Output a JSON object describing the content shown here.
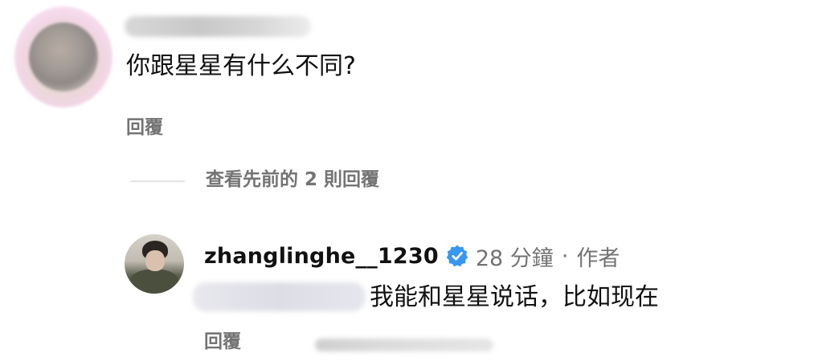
{
  "top_comment": {
    "text": "你跟星星有什么不同?",
    "reply_label": "回覆"
  },
  "view_previous": {
    "label": "查看先前的 2 則回覆"
  },
  "reply_comment": {
    "username": "zhanglinghe__1230",
    "time": "28 分鐘",
    "separator": "·",
    "author_tag": "作者",
    "text": "我能和星星说话，比如现在",
    "reply_label": "回覆"
  },
  "colors": {
    "verified_badge": "#3897f0",
    "secondary_text": "#737373",
    "primary_text": "#111111"
  },
  "icons": {
    "verified": "verified-badge-icon"
  }
}
